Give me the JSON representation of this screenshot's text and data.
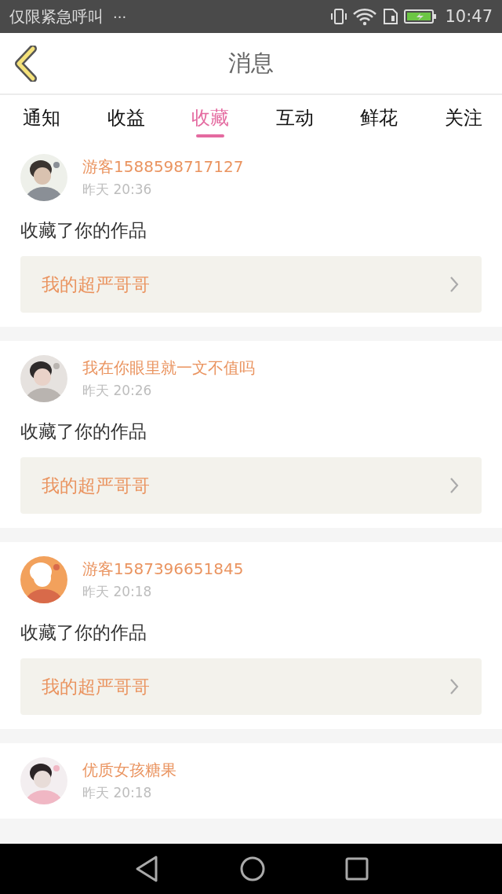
{
  "status_bar": {
    "carrier": "仅限紧急呼叫",
    "more": "···",
    "time": "10:47"
  },
  "header": {
    "title": "消息"
  },
  "tabs": [
    {
      "label": "通知",
      "selected": false
    },
    {
      "label": "收益",
      "selected": false
    },
    {
      "label": "收藏",
      "selected": true
    },
    {
      "label": "互动",
      "selected": false
    },
    {
      "label": "鲜花",
      "selected": false
    },
    {
      "label": "关注",
      "selected": false
    }
  ],
  "messages": [
    {
      "user": "游客1588598717127",
      "time": "昨天 20:36",
      "text": "收藏了你的作品",
      "work": "我的超严哥哥"
    },
    {
      "user": "我在你眼里就一文不值吗",
      "time": "昨天 20:26",
      "text": "收藏了你的作品",
      "work": "我的超严哥哥"
    },
    {
      "user": "游客1587396651845",
      "time": "昨天 20:18",
      "text": "收藏了你的作品",
      "work": "我的超严哥哥"
    },
    {
      "user": "优质女孩糖果",
      "time": "昨天 20:18"
    }
  ]
}
